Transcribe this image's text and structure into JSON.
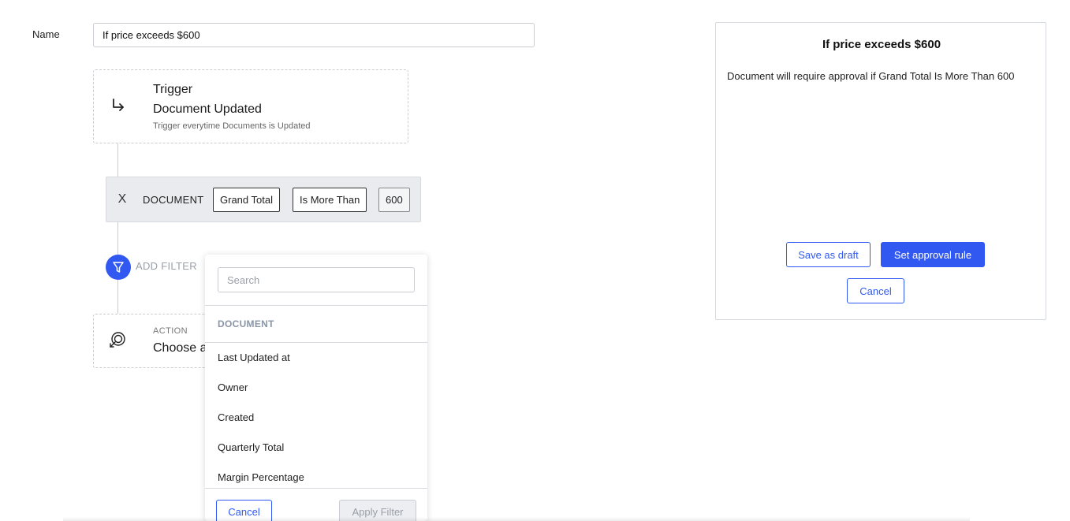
{
  "form": {
    "name_label": "Name",
    "name_value": "If price exceeds $600"
  },
  "trigger": {
    "label": "Trigger",
    "title": "Document Updated",
    "description": "Trigger everytime Documents is Updated",
    "icon": "arrow-down-right-icon"
  },
  "filter": {
    "remove_icon": "close-icon",
    "remove_symbol": "X",
    "entity": "DOCUMENT",
    "field": "Grand Total",
    "operator": "Is More Than",
    "value": "600"
  },
  "add_filter": {
    "label": "ADD FILTER",
    "icon": "funnel-icon"
  },
  "action": {
    "label": "ACTION",
    "title": "Choose ap",
    "icon": "touch-icon"
  },
  "dropdown": {
    "search_placeholder": "Search",
    "section": "DOCUMENT",
    "items": [
      "Last Updated at",
      "Owner",
      "Created",
      "Quarterly Total",
      "Margin Percentage"
    ],
    "cancel_label": "Cancel",
    "apply_label": "Apply Filter"
  },
  "preview": {
    "title": "If price exceeds $600",
    "description": "Document will require approval if Grand Total Is More Than 600",
    "save_draft_label": "Save as draft",
    "set_rule_label": "Set approval rule",
    "cancel_label": "Cancel"
  },
  "colors": {
    "accent": "#3158f0",
    "border": "#c9ccd1",
    "filter_row_bg": "#e9ebef",
    "muted_text": "#9aa0a8"
  }
}
